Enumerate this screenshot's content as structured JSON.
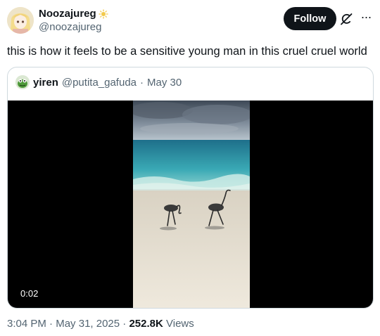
{
  "author": {
    "display_name": "Noozajureg",
    "handle": "@noozajureg",
    "badge_icon": "sun-emoji-icon"
  },
  "actions": {
    "follow_label": "Follow",
    "grok_icon": "grok-icon",
    "more_icon": "more-icon"
  },
  "tweet": {
    "text": "this is how it feels to be a sensitive young man in this cruel cruel world"
  },
  "quote": {
    "display_name": "yiren",
    "handle": "@putita_gafuda",
    "separator": "·",
    "date": "May 30",
    "video": {
      "time": "0:02"
    }
  },
  "meta": {
    "time": "3:04 PM",
    "separator": "·",
    "date": "May 31, 2025",
    "views_count": "252.8K",
    "views_label": "Views"
  },
  "colors": {
    "text": "#0f1419",
    "secondary": "#536471",
    "border": "#cfd9de",
    "follow_bg": "#0f1419"
  }
}
